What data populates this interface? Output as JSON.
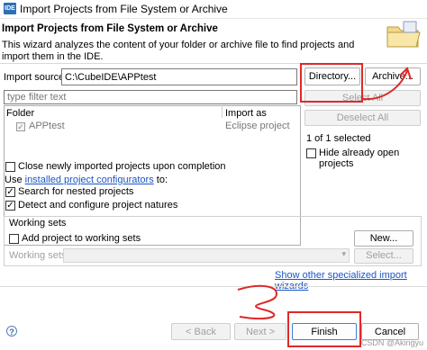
{
  "window": {
    "app_icon": "IDE",
    "title": "Import Projects from File System or Archive"
  },
  "header": {
    "title": "Import Projects from File System or Archive",
    "description": "This wizard analyzes the content of your folder or archive file to find projects and import them in the IDE.",
    "icon": "folder-icon"
  },
  "import_source": {
    "label": "Import source:",
    "value": "C:\\CubeIDE\\APPtest",
    "directory_button": "Directory...",
    "archive_button": "Archive..."
  },
  "filter": {
    "placeholder": "type filter text"
  },
  "table": {
    "columns": [
      "Folder",
      "Import as"
    ],
    "rows": [
      {
        "folder": "APPtest",
        "import_as": "Eclipse project",
        "checked": true
      }
    ]
  },
  "side_buttons": {
    "select_all": "Select All",
    "deselect_all": "Deselect All"
  },
  "selection_status": "1 of 1 selected",
  "hide_open_label": "Hide already open projects",
  "options": {
    "close_label": "Close newly imported projects upon completion",
    "use_prefix": "Use",
    "configurators_link": "installed project configurators",
    "use_suffix": "to:",
    "search_nested": "Search for nested projects",
    "detect_configure": "Detect and configure project natures"
  },
  "working_sets": {
    "group_label": "Working sets",
    "add_label": "Add project to working sets",
    "new_button": "New...",
    "combo_label": "Working sets:",
    "select_button": "Select..."
  },
  "specialized_link": "Show other specialized import wizards",
  "footer": {
    "back": "< Back",
    "next": "Next >",
    "finish": "Finish",
    "cancel": "Cancel"
  },
  "watermark": "CSDN @Akingyu",
  "colors": {
    "annotation_red": "#e02828",
    "link_blue": "#1a56c4"
  }
}
